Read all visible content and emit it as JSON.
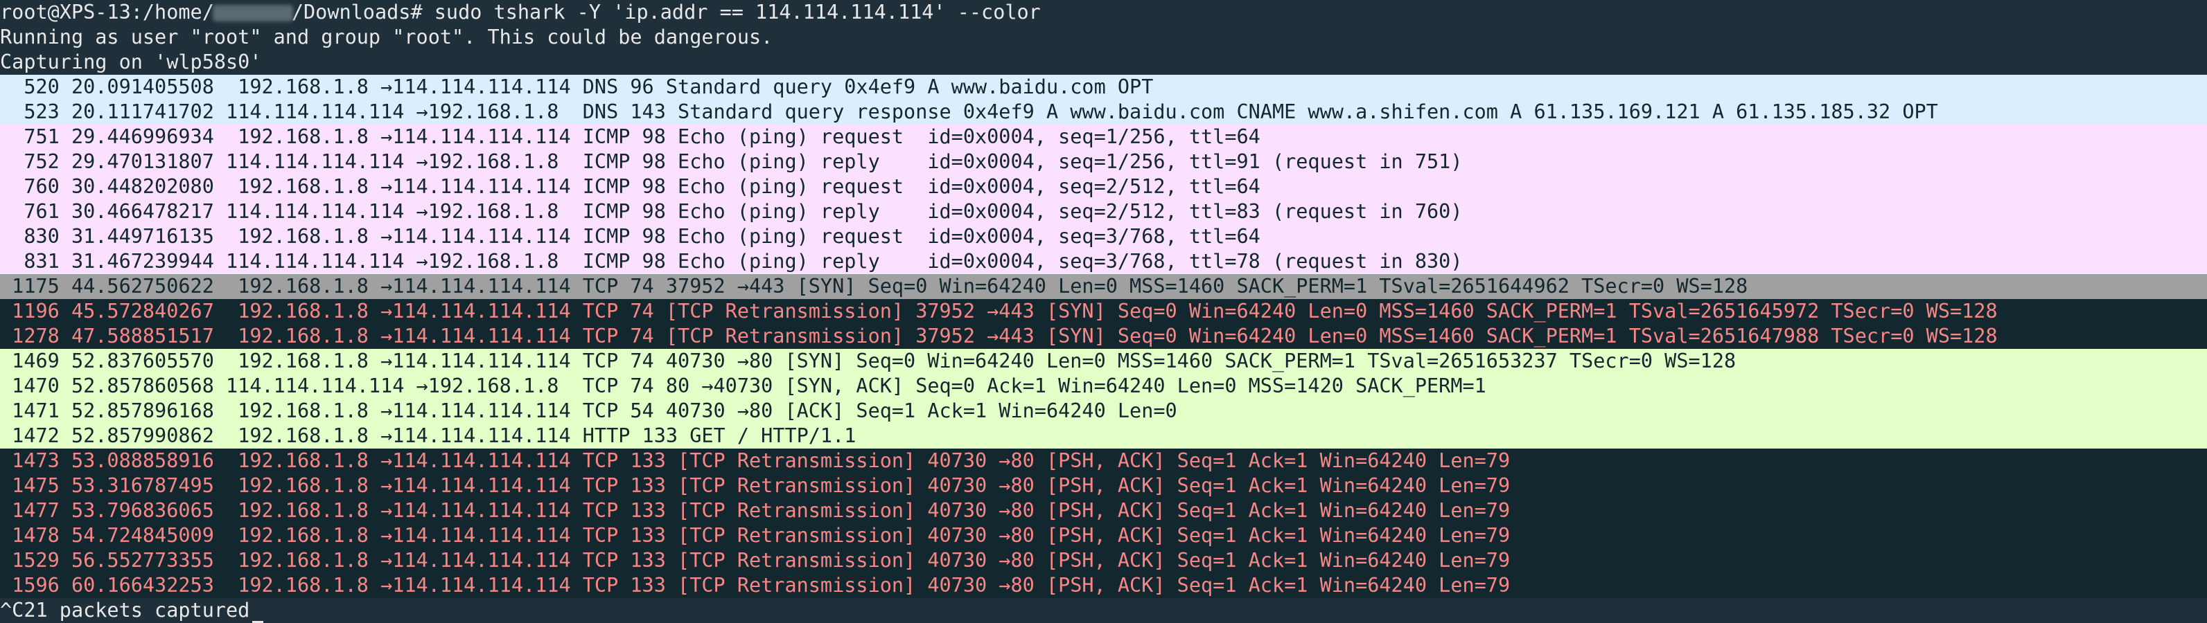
{
  "prompt": {
    "prefix": "root@XPS-13:/home/",
    "suffix": "/Downloads# sudo tshark -Y 'ip.addr == 114.114.114.114' --color"
  },
  "messages": [
    "Running as user \"root\" and group \"root\". This could be dangerous.",
    "Capturing on 'wlp58s0'"
  ],
  "packets": [
    {
      "text": "  520 20.091405508  192.168.1.8 →114.114.114.114 DNS 96 Standard query 0x4ef9 A www.baidu.com OPT",
      "style": "dns"
    },
    {
      "text": "  523 20.111741702 114.114.114.114 →192.168.1.8  DNS 143 Standard query response 0x4ef9 A www.baidu.com CNAME www.a.shifen.com A 61.135.169.121 A 61.135.185.32 OPT",
      "style": "dns"
    },
    {
      "text": "  751 29.446996934  192.168.1.8 →114.114.114.114 ICMP 98 Echo (ping) request  id=0x0004, seq=1/256, ttl=64",
      "style": "icmp"
    },
    {
      "text": "  752 29.470131807 114.114.114.114 →192.168.1.8  ICMP 98 Echo (ping) reply    id=0x0004, seq=1/256, ttl=91 (request in 751)",
      "style": "icmp"
    },
    {
      "text": "  760 30.448202080  192.168.1.8 →114.114.114.114 ICMP 98 Echo (ping) request  id=0x0004, seq=2/512, ttl=64",
      "style": "icmp"
    },
    {
      "text": "  761 30.466478217 114.114.114.114 →192.168.1.8  ICMP 98 Echo (ping) reply    id=0x0004, seq=2/512, ttl=83 (request in 760)",
      "style": "icmp"
    },
    {
      "text": "  830 31.449716135  192.168.1.8 →114.114.114.114 ICMP 98 Echo (ping) request  id=0x0004, seq=3/768, ttl=64",
      "style": "icmp"
    },
    {
      "text": "  831 31.467239944 114.114.114.114 →192.168.1.8  ICMP 98 Echo (ping) reply    id=0x0004, seq=3/768, ttl=78 (request in 830)",
      "style": "icmp"
    },
    {
      "text": " 1175 44.562750622  192.168.1.8 →114.114.114.114 TCP 74 37952 →443 [SYN] Seq=0 Win=64240 Len=0 MSS=1460 SACK_PERM=1 TSval=2651644962 TSecr=0 WS=128",
      "style": "syn"
    },
    {
      "text": " 1196 45.572840267  192.168.1.8 →114.114.114.114 TCP 74 [TCP Retransmission] 37952 →443 [SYN] Seq=0 Win=64240 Len=0 MSS=1460 SACK_PERM=1 TSval=2651645972 TSecr=0 WS=128",
      "style": "bad"
    },
    {
      "text": " 1278 47.588851517  192.168.1.8 →114.114.114.114 TCP 74 [TCP Retransmission] 37952 →443 [SYN] Seq=0 Win=64240 Len=0 MSS=1460 SACK_PERM=1 TSval=2651647988 TSecr=0 WS=128",
      "style": "bad"
    },
    {
      "text": " 1469 52.837605570  192.168.1.8 →114.114.114.114 TCP 74 40730 →80 [SYN] Seq=0 Win=64240 Len=0 MSS=1460 SACK_PERM=1 TSval=2651653237 TSecr=0 WS=128",
      "style": "http"
    },
    {
      "text": " 1470 52.857860568 114.114.114.114 →192.168.1.8  TCP 74 80 →40730 [SYN, ACK] Seq=0 Ack=1 Win=64240 Len=0 MSS=1420 SACK_PERM=1",
      "style": "http"
    },
    {
      "text": " 1471 52.857896168  192.168.1.8 →114.114.114.114 TCP 54 40730 →80 [ACK] Seq=1 Ack=1 Win=64240 Len=0",
      "style": "http"
    },
    {
      "text": " 1472 52.857990862  192.168.1.8 →114.114.114.114 HTTP 133 GET / HTTP/1.1",
      "style": "http"
    },
    {
      "text": " 1473 53.088858916  192.168.1.8 →114.114.114.114 TCP 133 [TCP Retransmission] 40730 →80 [PSH, ACK] Seq=1 Ack=1 Win=64240 Len=79",
      "style": "bad"
    },
    {
      "text": " 1475 53.316787495  192.168.1.8 →114.114.114.114 TCP 133 [TCP Retransmission] 40730 →80 [PSH, ACK] Seq=1 Ack=1 Win=64240 Len=79",
      "style": "bad"
    },
    {
      "text": " 1477 53.796836065  192.168.1.8 →114.114.114.114 TCP 133 [TCP Retransmission] 40730 →80 [PSH, ACK] Seq=1 Ack=1 Win=64240 Len=79",
      "style": "bad"
    },
    {
      "text": " 1478 54.724845009  192.168.1.8 →114.114.114.114 TCP 133 [TCP Retransmission] 40730 →80 [PSH, ACK] Seq=1 Ack=1 Win=64240 Len=79",
      "style": "bad"
    },
    {
      "text": " 1529 56.552773355  192.168.1.8 →114.114.114.114 TCP 133 [TCP Retransmission] 40730 →80 [PSH, ACK] Seq=1 Ack=1 Win=64240 Len=79",
      "style": "bad"
    },
    {
      "text": " 1596 60.166432253  192.168.1.8 →114.114.114.114 TCP 133 [TCP Retransmission] 40730 →80 [PSH, ACK] Seq=1 Ack=1 Win=64240 Len=79",
      "style": "bad"
    }
  ],
  "footer": "^C21 packets captured",
  "colors": {
    "terminal_bg": "#20303a",
    "dns": "#daeeff",
    "icmp": "#fce0ff",
    "syn": "#a0a0a0",
    "bad_bg": "#12272e",
    "bad_fg": "#f78787",
    "http": "#e4ffc7"
  }
}
